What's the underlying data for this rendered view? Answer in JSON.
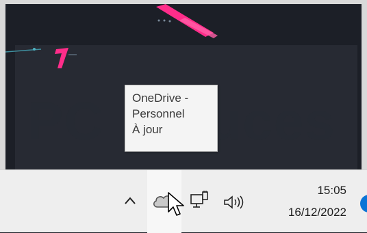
{
  "tooltip": {
    "line1": "OneDrive -",
    "line2": "Personnel",
    "line3": "À jour"
  },
  "tray": {
    "icons": [
      "chevron-up-icon",
      "onedrive-cloud-icon",
      "network-icon",
      "speaker-icon"
    ]
  },
  "clock": {
    "time": "15:05",
    "date": "16/12/2022"
  },
  "colors": {
    "taskbar": "#eeeeee",
    "accent_pink": "#ff2d8a",
    "notification_blue": "#0a74d6",
    "desktop": "#1c1f27"
  }
}
